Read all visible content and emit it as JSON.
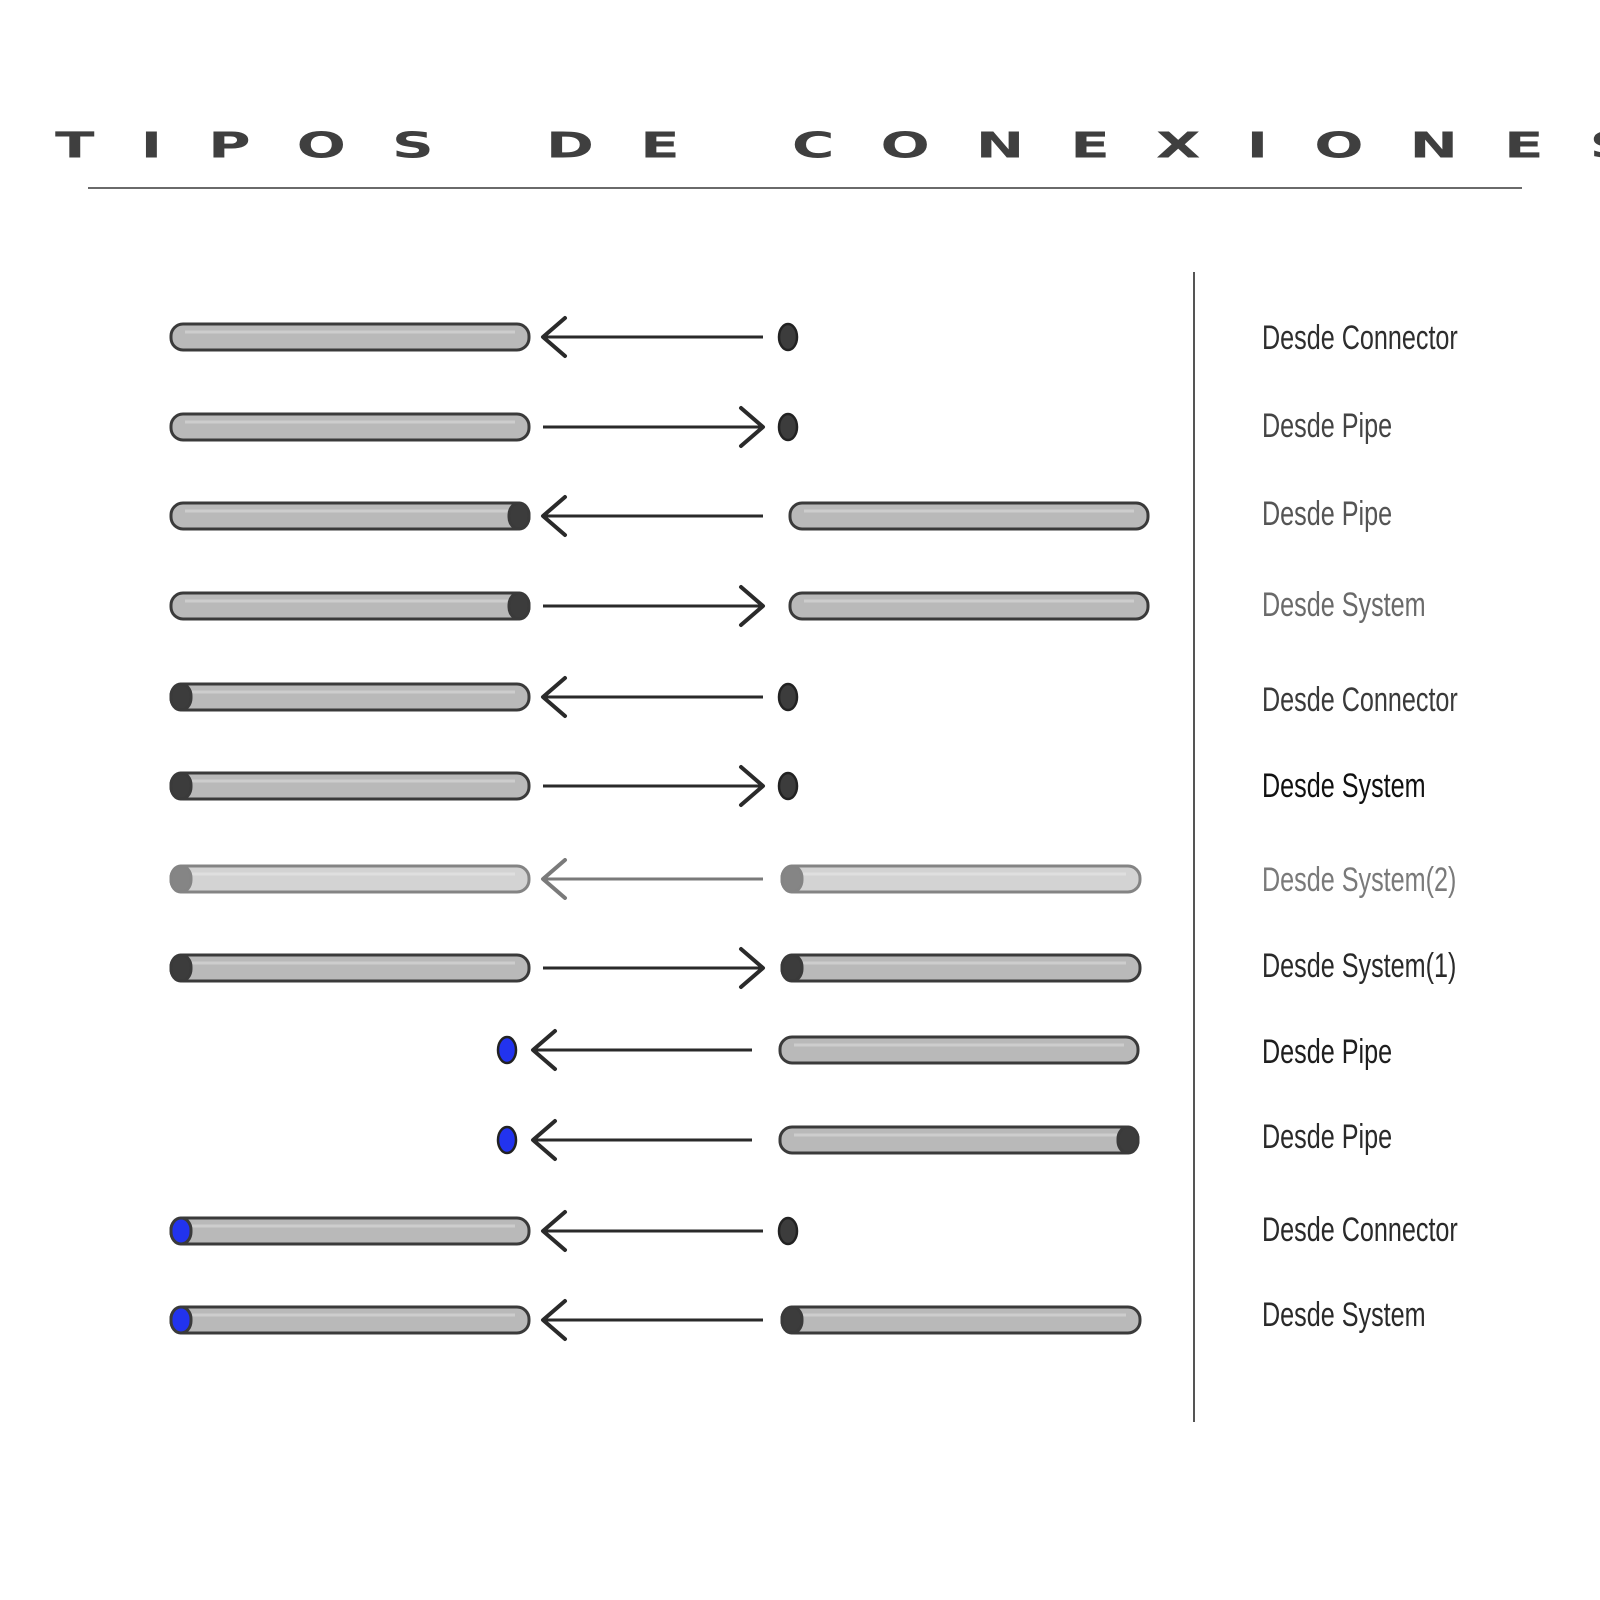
{
  "title": "Tipos de conexiones",
  "colors": {
    "pipe_fill": "#b9b9b9",
    "pipe_stroke": "#3a3a3a",
    "connector": "#3c3c3c",
    "blue_connector": "#2233ee",
    "arrow": "#2a2a2a"
  },
  "rows": [
    {
      "label": "Desde Connector",
      "label_color": "#2e2e2e",
      "left": "pipe",
      "left_cap": "none",
      "arrow": "left",
      "right": "connector",
      "right_cap": "none",
      "faded": false
    },
    {
      "label": "Desde Pipe",
      "label_color": "#444444",
      "left": "pipe",
      "left_cap": "none",
      "arrow": "right",
      "right": "connector",
      "right_cap": "none",
      "faded": false
    },
    {
      "label": "Desde Pipe",
      "label_color": "#555555",
      "left": "pipe",
      "left_cap": "right-dark",
      "arrow": "left",
      "right": "pipe",
      "right_cap": "none",
      "faded": false
    },
    {
      "label": "Desde System",
      "label_color": "#6a6a6a",
      "left": "pipe",
      "left_cap": "right-dark",
      "arrow": "right",
      "right": "pipe",
      "right_cap": "none",
      "faded": false
    },
    {
      "label": "Desde Connector",
      "label_color": "#3a3a3a",
      "left": "pipe",
      "left_cap": "left-dark",
      "arrow": "left",
      "right": "connector",
      "right_cap": "none",
      "faded": false
    },
    {
      "label": "Desde System",
      "label_color": "#111111",
      "left": "pipe",
      "left_cap": "left-dark",
      "arrow": "right",
      "right": "connector",
      "right_cap": "none",
      "faded": false
    },
    {
      "label": "Desde System(2)",
      "label_color": "#7a7a7a",
      "left": "pipe",
      "left_cap": "left-dark",
      "arrow": "left",
      "right": "pipe",
      "right_cap": "left-dark",
      "faded": true
    },
    {
      "label": "Desde System(1)",
      "label_color": "#2a2a2a",
      "left": "pipe",
      "left_cap": "left-dark",
      "arrow": "right",
      "right": "pipe",
      "right_cap": "left-dark",
      "faded": false
    },
    {
      "label": "Desde Pipe",
      "label_color": "#1e1e1e",
      "left": "blue-connector",
      "left_cap": "none",
      "arrow": "left",
      "right": "pipe",
      "right_cap": "none",
      "faded": false
    },
    {
      "label": "Desde Pipe",
      "label_color": "#2a2a2a",
      "left": "blue-connector",
      "left_cap": "none",
      "arrow": "left",
      "right": "pipe",
      "right_cap": "right-dark",
      "faded": false
    },
    {
      "label": "Desde Connector",
      "label_color": "#2a2a2a",
      "left": "pipe",
      "left_cap": "left-blue",
      "arrow": "left",
      "right": "connector",
      "right_cap": "none",
      "faded": false
    },
    {
      "label": "Desde System",
      "label_color": "#2a2a2a",
      "left": "pipe",
      "left_cap": "left-blue",
      "arrow": "left",
      "right": "pipe",
      "right_cap": "left-dark",
      "faded": false
    }
  ]
}
